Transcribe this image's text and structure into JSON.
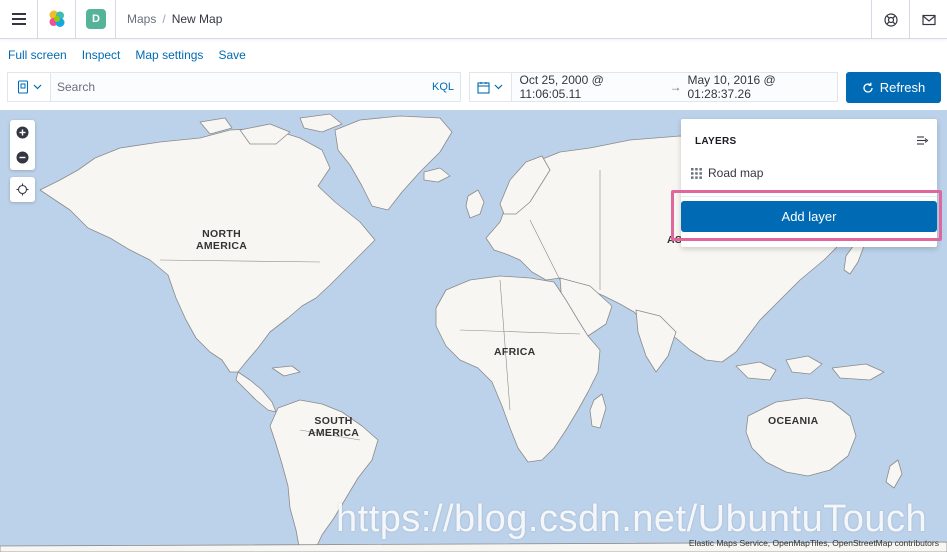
{
  "header": {
    "space_initial": "D",
    "breadcrumbs": [
      "Maps",
      "New Map"
    ],
    "icons": [
      "menu-icon",
      "elastic-logo-icon",
      "help-icon",
      "mail-icon"
    ]
  },
  "topnav": {
    "items": [
      "Full screen",
      "Inspect",
      "Map settings",
      "Save"
    ]
  },
  "query_bar": {
    "search_placeholder": "Search",
    "language_label": "KQL",
    "date_start": "Oct 25, 2000 @ 11:06:05.11",
    "date_arrow": "→",
    "date_end": "May 10, 2016 @ 01:28:37.26",
    "refresh_label": "Refresh"
  },
  "map": {
    "labels": {
      "north_america": [
        "NORTH",
        "AMERICA"
      ],
      "south_america": [
        "SOUTH",
        "AMERICA"
      ],
      "africa": "AFRICA",
      "asia": "ASIA",
      "oceania": "OCEANIA"
    },
    "attribution": "Elastic Maps Service, OpenMapTiles, OpenStreetMap contributors",
    "colors": {
      "water": "#bcd2ea",
      "land": "#f7f6f2",
      "border": "#8a8a8a"
    }
  },
  "layers_panel": {
    "title": "LAYERS",
    "layers": [
      {
        "name": "Road map",
        "icon": "grid-icon"
      }
    ],
    "add_layer_label": "Add layer",
    "highlight_color": "#e0679b"
  },
  "watermark": "https://blog.csdn.net/UbuntuTouch",
  "colors": {
    "primary": "#006bb4",
    "space_avatar": "#54b399"
  }
}
